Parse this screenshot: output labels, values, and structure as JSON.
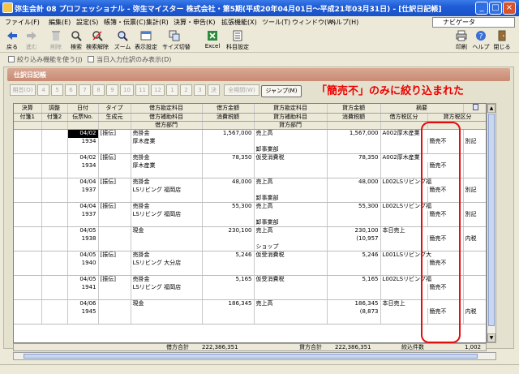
{
  "window": {
    "title": "弥生会計 08 プロフェッショナル - 弥生マイスター 株式会社・第5期(平成20年04月01日～平成21年03月31日) - [仕訳日記帳]"
  },
  "menu": [
    "ファイル(F)",
    "編集(E)",
    "設定(S)",
    "帳簿・伝票(C)",
    "集計(R)",
    "決算・申告(K)",
    "拡張機能(X)",
    "ツール(T)",
    "ウィンドウ(W)",
    "ヘルプ(H)"
  ],
  "navi": "ナビゲータ",
  "toolbar": {
    "left": [
      "戻る",
      "進む",
      "削除",
      "検索",
      "検索解除",
      "ズーム",
      "表示設定",
      "サイズ切替",
      "Excel",
      "科目設定"
    ],
    "right": [
      "印刷",
      "ヘルプ",
      "閉じる"
    ]
  },
  "options": [
    "絞り込み機能を使う(J)",
    "当日入力仕訳のみ表示(D)"
  ],
  "panel": {
    "title": "仕訳日記帳"
  },
  "periods": [
    "期首(O)",
    "4",
    "5",
    "6",
    "7",
    "8",
    "9",
    "10",
    "11",
    "12",
    "1",
    "2",
    "3",
    "決",
    "全期間(W)"
  ],
  "jump_label": "ジャンプ(M)",
  "annotation": "「簡売不」のみに絞り込まれた",
  "headers": {
    "r1": [
      "決算",
      "調整",
      "日付",
      "タイプ",
      "借方勘定科目",
      "借方金額",
      "貸方勘定科目",
      "貸方金額",
      "",
      "摘要",
      ""
    ],
    "r2": [
      "付箋1",
      "付箋2",
      "伝票No.",
      "生成元",
      "借方補助科目",
      "消費税額",
      "貸方補助科目",
      "消費税額",
      "借方税区分",
      "貸方税区分",
      ""
    ],
    "r3": [
      "",
      "",
      "",
      "",
      "借方部門",
      "",
      "貸方部門",
      "",
      "",
      "",
      ""
    ]
  },
  "rows": [
    {
      "date": "04/02",
      "no": "1934",
      "type": "[振伝]",
      "dr": "売掛金",
      "dr_sub": "厚木産業",
      "dr_amt": "1,567,000",
      "dr_tax": "",
      "cr": "売上高",
      "cr_sub": "",
      "cr_dept": "卸事業部",
      "cr_amt": "1,567,000",
      "cr_tax": "",
      "memo": "A002厚木産業",
      "dr_tk": "",
      "cr_tk": "簡売不",
      "cr_mode": "別記",
      "sel": true
    },
    {
      "date": "04/02",
      "no": "1934",
      "type": "[振伝]",
      "dr": "売掛金",
      "dr_sub": "厚木産業",
      "dr_amt": "78,350",
      "dr_tax": "",
      "cr": "仮受消費税",
      "cr_sub": "",
      "cr_dept": "",
      "cr_amt": "78,350",
      "cr_tax": "",
      "memo": "A002厚木産業",
      "dr_tk": "",
      "cr_tk": "簡売不",
      "cr_mode": "",
      "sel": false
    },
    {
      "date": "04/04",
      "no": "1937",
      "type": "[振伝]",
      "dr": "売掛金",
      "dr_sub": "LSリビング 福岡店",
      "dr_amt": "48,000",
      "dr_tax": "",
      "cr": "売上高",
      "cr_sub": "",
      "cr_dept": "卸事業部",
      "cr_amt": "48,000",
      "cr_tax": "",
      "memo": "L002LSリビング福",
      "dr_tk": "",
      "cr_tk": "簡売不",
      "cr_mode": "別記",
      "sel": false
    },
    {
      "date": "04/04",
      "no": "1937",
      "type": "[振伝]",
      "dr": "売掛金",
      "dr_sub": "LSリビング 福岡店",
      "dr_amt": "55,300",
      "dr_tax": "",
      "cr": "売上高",
      "cr_sub": "",
      "cr_dept": "卸事業部",
      "cr_amt": "55,300",
      "cr_tax": "",
      "memo": "L002LSリビング福",
      "dr_tk": "",
      "cr_tk": "簡売不",
      "cr_mode": "別記",
      "sel": false
    },
    {
      "date": "04/05",
      "no": "1938",
      "type": "",
      "dr": "現金",
      "dr_sub": "",
      "dr_amt": "230,100",
      "dr_tax": "",
      "cr": "売上高",
      "cr_sub": "",
      "cr_dept": "ショップ",
      "cr_amt": "230,100",
      "cr_tax": "(10,957",
      "memo": "本日売上",
      "dr_tk": "",
      "cr_tk": "簡売不",
      "cr_mode": "内税",
      "sel": false
    },
    {
      "date": "04/05",
      "no": "1940",
      "type": "[振伝]",
      "dr": "売掛金",
      "dr_sub": "LSリビング 大分店",
      "dr_amt": "5,246",
      "dr_tax": "",
      "cr": "仮受消費税",
      "cr_sub": "",
      "cr_dept": "",
      "cr_amt": "5,246",
      "cr_tax": "",
      "memo": "L001LSリビング大",
      "dr_tk": "",
      "cr_tk": "簡売不",
      "cr_mode": "",
      "sel": false
    },
    {
      "date": "04/05",
      "no": "1941",
      "type": "[振伝]",
      "dr": "売掛金",
      "dr_sub": "LSリビング 福岡店",
      "dr_amt": "5,165",
      "dr_tax": "",
      "cr": "仮受消費税",
      "cr_sub": "",
      "cr_dept": "",
      "cr_amt": "5,165",
      "cr_tax": "",
      "memo": "L002LSリビング福",
      "dr_tk": "",
      "cr_tk": "簡売不",
      "cr_mode": "",
      "sel": false
    },
    {
      "date": "04/06",
      "no": "1945",
      "type": "",
      "dr": "現金",
      "dr_sub": "",
      "dr_amt": "186,345",
      "dr_tax": "",
      "cr": "売上高",
      "cr_sub": "",
      "cr_dept": "",
      "cr_amt": "186,345",
      "cr_tax": "(8,873",
      "memo": "本日売上",
      "dr_tk": "",
      "cr_tk": "簡売不",
      "cr_mode": "内税",
      "sel": false
    }
  ],
  "totals": {
    "dr_label": "借方合計",
    "dr_value": "222,386,351",
    "cr_label": "貸方合計",
    "cr_value": "222,386,351",
    "count_label": "絞込件数",
    "count_value": "1,002"
  }
}
